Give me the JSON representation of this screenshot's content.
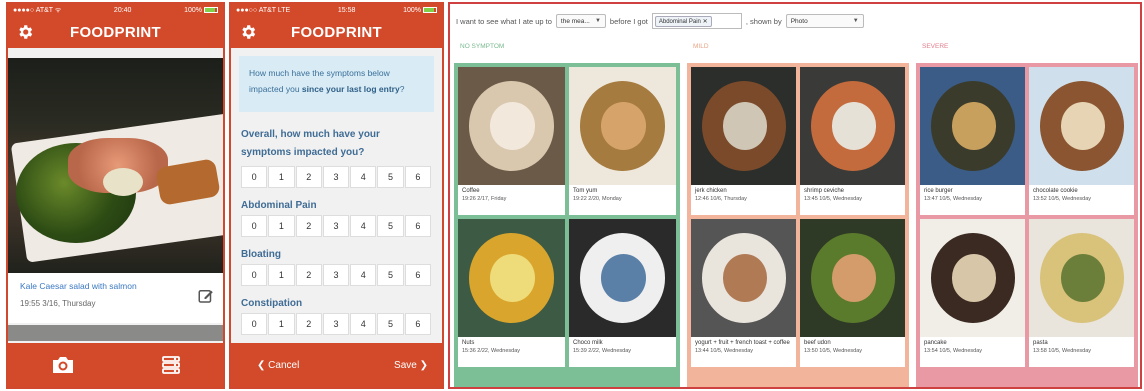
{
  "phone1": {
    "status": {
      "carrier": "●●●●○ AT&T ᯤ",
      "time": "20:40",
      "battery": "100%"
    },
    "app_title": "FOODPRINT",
    "entry": {
      "name": "Kale Caesar salad with salmon",
      "time": "19:55 3/16, Thursday"
    }
  },
  "phone2": {
    "status": {
      "carrier": "●●●○○ AT&T  LTE",
      "time": "15:58",
      "battery": "100%"
    },
    "app_title": "FOODPRINT",
    "question_prefix": "How much have the symptoms below impacted you ",
    "question_bold": "since your last log entry",
    "question_suffix": "?",
    "overall_label": "Overall, how much have your symptoms impacted you?",
    "scale": [
      "0",
      "1",
      "2",
      "3",
      "4",
      "5",
      "6"
    ],
    "symptoms": [
      "Abdominal Pain",
      "Bloating",
      "Constipation"
    ],
    "cancel_label": "Cancel",
    "save_label": "Save"
  },
  "desktop": {
    "filter": {
      "part1": "I want to see what I ate up to",
      "select1": "the mea...",
      "part2": "before I got",
      "chip": "Abdominal Pain",
      "part3": ", shown by",
      "select2": "Photo"
    },
    "columns": [
      {
        "label": "NO SYMPTOM",
        "color": "#7cbf96",
        "label_color": "#79b98f",
        "items": [
          {
            "name": "Coffee",
            "time": "19:26 2/17, Friday"
          },
          {
            "name": "Tom yum",
            "time": "19:22 2/20, Monday"
          },
          {
            "name": "Nuts",
            "time": "15:36 2/22, Wednesday"
          },
          {
            "name": "Choco milk",
            "time": "15:39 2/22, Wednesday"
          }
        ]
      },
      {
        "label": "MILD",
        "color": "#f2b49a",
        "label_color": "#e8a487",
        "items": [
          {
            "name": "jerk chicken",
            "time": "12:46 10/6, Thursday"
          },
          {
            "name": "shrimp ceviche",
            "time": "13:45 10/5, Wednesday"
          },
          {
            "name": "yogurt + fruit + french toast + coffee",
            "time": "13:44 10/5, Wednesday"
          },
          {
            "name": "beef udon",
            "time": "13:50 10/5, Wednesday"
          }
        ]
      },
      {
        "label": "SEVERE",
        "color": "#e899a3",
        "label_color": "#e07c8a",
        "items": [
          {
            "name": "rice burger",
            "time": "13:47 10/5, Wednesday"
          },
          {
            "name": "chocolate cookie",
            "time": "13:52 10/5, Wednesday"
          },
          {
            "name": "pancake",
            "time": "13:54 10/5, Wednesday"
          },
          {
            "name": "pasta",
            "time": "13:58 10/5, Wednesday"
          }
        ]
      }
    ]
  },
  "colors": {
    "brand": "#d34a2b",
    "link": "#3a78c2",
    "question_bg": "#d9ecf5"
  },
  "icons": [
    "gear-icon",
    "edit-icon",
    "camera-icon",
    "list-icon",
    "chevron-left-icon",
    "chevron-right-icon",
    "close-icon",
    "caret-down-icon"
  ]
}
